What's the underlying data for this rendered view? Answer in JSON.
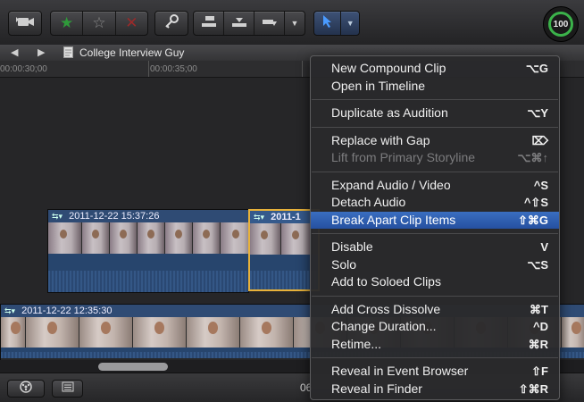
{
  "toolbar": {
    "meter_value": "100"
  },
  "path_bar": {
    "project_title": "College Interview Guy"
  },
  "ruler": {
    "ticks": [
      "00:00:30;00",
      "00:00:35;00"
    ]
  },
  "timeline": {
    "connected_clip_1_timestamp": "2011-12-22 15:37:26",
    "connected_clip_2_timestamp": "2011-1",
    "primary_clip_timestamp": "2011-12-22 12:35:30"
  },
  "bottom_bar": {
    "timecode_partial": "06"
  },
  "context_menu": {
    "groups": [
      [
        {
          "label": "New Compound Clip",
          "shortcut": "⌥G",
          "state": "normal"
        },
        {
          "label": "Open in Timeline",
          "shortcut": "",
          "state": "normal"
        }
      ],
      [
        {
          "label": "Duplicate as Audition",
          "shortcut": "⌥Y",
          "state": "normal"
        }
      ],
      [
        {
          "label": "Replace with Gap",
          "shortcut": "⌦",
          "state": "normal"
        },
        {
          "label": "Lift from Primary Storyline",
          "shortcut": "⌥⌘↑",
          "state": "disabled"
        }
      ],
      [
        {
          "label": "Expand Audio / Video",
          "shortcut": "^S",
          "state": "normal"
        },
        {
          "label": "Detach Audio",
          "shortcut": "^⇧S",
          "state": "normal"
        },
        {
          "label": "Break Apart Clip Items",
          "shortcut": "⇧⌘G",
          "state": "highlight"
        }
      ],
      [
        {
          "label": "Disable",
          "shortcut": "V",
          "state": "normal"
        },
        {
          "label": "Solo",
          "shortcut": "⌥S",
          "state": "normal"
        },
        {
          "label": "Add to Soloed Clips",
          "shortcut": "",
          "state": "normal"
        }
      ],
      [
        {
          "label": "Add Cross Dissolve",
          "shortcut": "⌘T",
          "state": "normal"
        },
        {
          "label": "Change Duration...",
          "shortcut": "^D",
          "state": "normal"
        },
        {
          "label": "Retime...",
          "shortcut": "⌘R",
          "state": "normal"
        }
      ],
      [
        {
          "label": "Reveal in Event Browser",
          "shortcut": "⇧F",
          "state": "normal"
        },
        {
          "label": "Reveal in Finder",
          "shortcut": "⇧⌘R",
          "state": "normal"
        }
      ]
    ]
  },
  "colors": {
    "menu_highlight": "#2d5ea8",
    "clip_header": "#2f4b74",
    "selected_clip_border": "#e8b23a",
    "meter_ring": "#3bb24a"
  }
}
